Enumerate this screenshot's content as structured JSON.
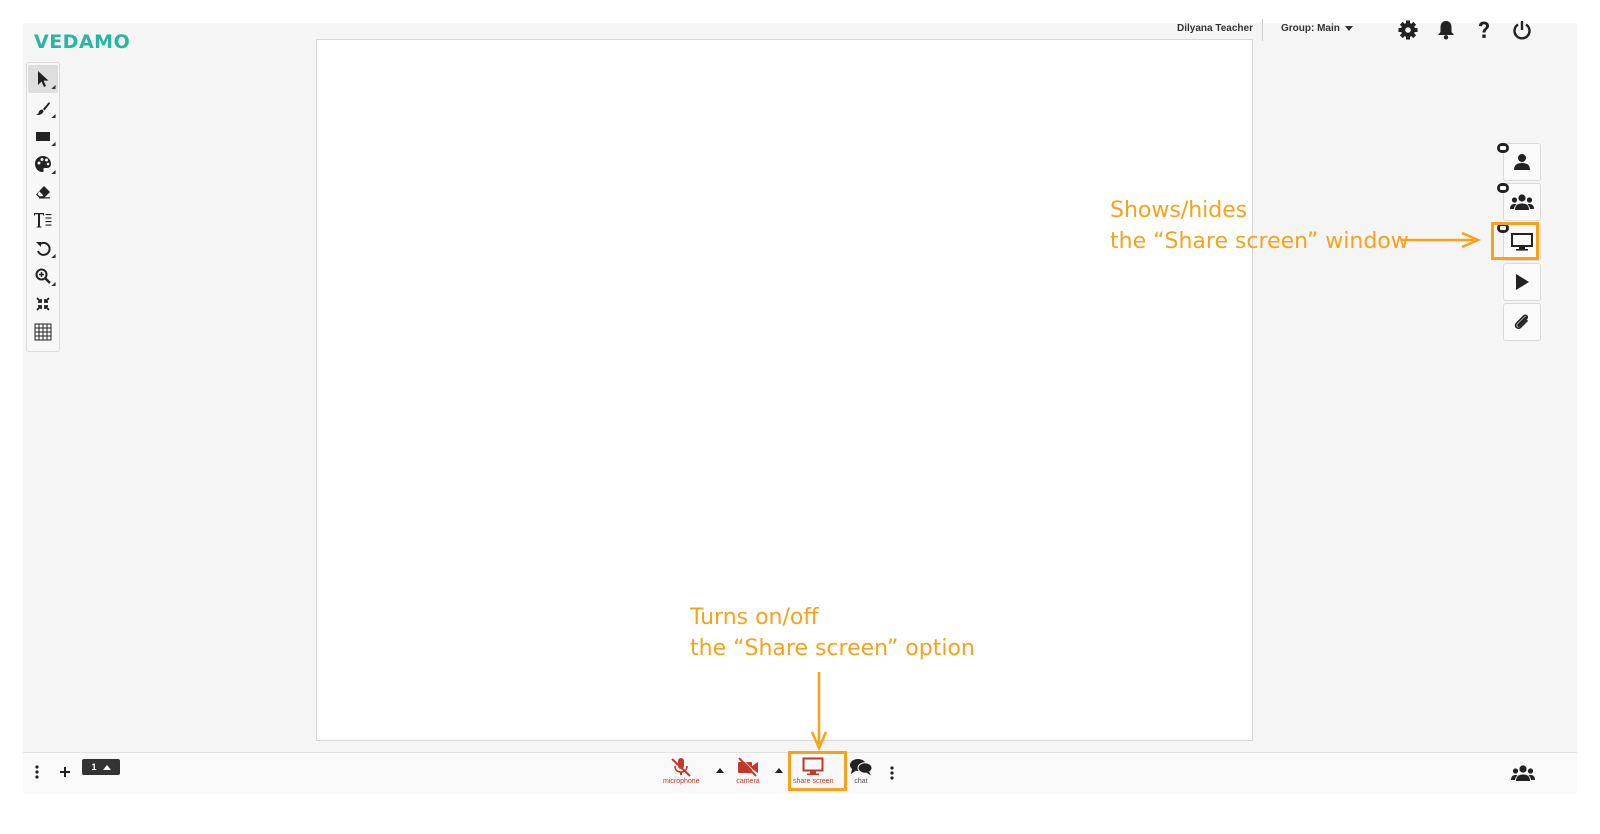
{
  "app": {
    "logo": "VEDAMO",
    "brand_color": "#27b5a4",
    "accent_color": "#f7a21b",
    "alert_color": "#c0392b"
  },
  "toolbar": {
    "tools": [
      {
        "name": "select-tool",
        "icon": "cursor-arrow-icon",
        "active": true
      },
      {
        "name": "pen-tool",
        "icon": "brush-icon",
        "active": false
      },
      {
        "name": "shape-tool",
        "icon": "rectangle-icon",
        "active": false
      },
      {
        "name": "color-tool",
        "icon": "palette-icon",
        "active": false
      },
      {
        "name": "eraser-tool",
        "icon": "eraser-icon",
        "active": false
      },
      {
        "name": "text-tool",
        "icon": "text-icon",
        "active": false
      },
      {
        "name": "undo-tool",
        "icon": "undo-icon",
        "active": false
      },
      {
        "name": "zoom-tool",
        "icon": "zoom-in-icon",
        "active": false
      },
      {
        "name": "fit-tool",
        "icon": "compress-icon",
        "active": false
      },
      {
        "name": "grid-tool",
        "icon": "grid-icon",
        "active": false
      }
    ]
  },
  "header": {
    "user_name": "Dilyana Teacher",
    "group_label": "Group: Main"
  },
  "right_panel": {
    "buttons": [
      {
        "name": "teacher-video-toggle",
        "icon": "user-icon"
      },
      {
        "name": "participants-video-toggle",
        "icon": "users-icon"
      },
      {
        "name": "share-screen-window-toggle",
        "icon": "monitor-icon"
      },
      {
        "name": "media-player-toggle",
        "icon": "play-icon"
      },
      {
        "name": "files-toggle",
        "icon": "paperclip-icon"
      }
    ]
  },
  "bottom_bar": {
    "page_number": "1",
    "microphone_label": "microphone",
    "camera_label": "camera",
    "share_screen_label": "share screen",
    "chat_label": "chat"
  },
  "annotations": {
    "right_line1": "Shows/hides",
    "right_line2": "the “Share screen” window",
    "bottom_line1": "Turns on/off",
    "bottom_line2": "the “Share screen” option"
  }
}
